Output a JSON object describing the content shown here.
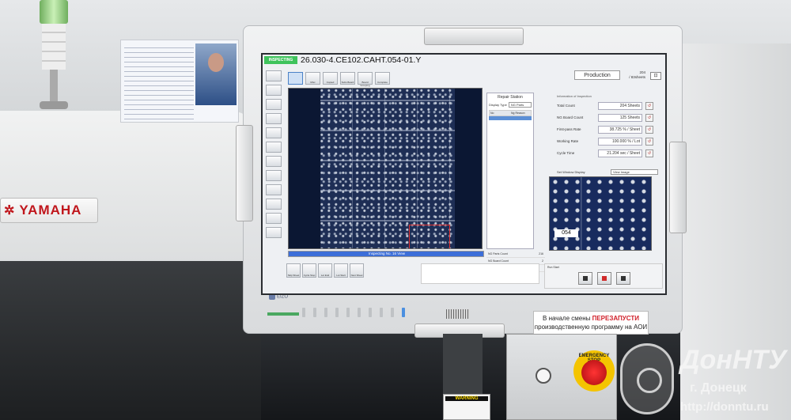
{
  "screen": {
    "status": "INSPECTING",
    "program_name": "26.030-4.CE102.CAHT.054-01.Y",
    "mode": "Production",
    "sheet_count": "204",
    "sheet_unit": "/ 83sheets",
    "fullscreen_icon": "fullscreen-icon",
    "left_tools": [
      "",
      "",
      "",
      "",
      "",
      "",
      "",
      "",
      "",
      "",
      "",
      ""
    ],
    "top_tools": [
      "",
      "Misc",
      "Copied",
      "Subs Board",
      "Board Grouping",
      "Complete"
    ],
    "repair_station": {
      "title": "Repair Station",
      "display_type_label": "Display Type",
      "display_type_value": "NG Parts",
      "col_no": "No",
      "col_name": "Ng Reason"
    },
    "inspect_info": [
      {
        "label": "NG Parts Count",
        "value": "216"
      },
      {
        "label": "NG Board Count",
        "value": "2"
      },
      {
        "label": "NG Sheet Count",
        "value": ""
      }
    ],
    "stats_title": "Information of Inspection",
    "stats": [
      {
        "label": "Total Count",
        "value": "204",
        "unit": "Sheets"
      },
      {
        "label": "NG Board Count",
        "value": "125",
        "unit": "Sheets"
      },
      {
        "label": "First-pass Rate",
        "value": "38.725",
        "unit": "% / Sheet"
      },
      {
        "label": "Working Rate",
        "value": "100.000",
        "unit": "% / Lot"
      },
      {
        "label": "Cycle Time",
        "value": "21.204",
        "unit": "sec / Sheet"
      }
    ],
    "view_label": "Set Window Display",
    "view_option": "View Image",
    "component_label": "054",
    "progress_text": "Inspecting No. 16 View",
    "progress_value": 1.0,
    "bottom_buttons": [
      "Skip Sheet",
      "Cycle Stop",
      "Lot End",
      "Lot Start",
      "Next Sheet"
    ],
    "run_area_label": "Run Start"
  },
  "environment": {
    "brand": "YAMAHA",
    "sticker_line1_prefix": "В начале смены ",
    "sticker_line1_emphasis": "ПЕРЕЗАПУСТИ",
    "sticker_line2": "производственную программу на АОИ",
    "monitor_brand": "EIZO",
    "estop_label": "EMERGENCY STOP",
    "warning": "WARNING",
    "watermark_title": "ДонНТУ",
    "watermark_city": "г. Донецк",
    "watermark_url": "http://donntu.ru"
  },
  "colors": {
    "status_green": "#3fc35c",
    "progress_blue": "#3c6ed8",
    "estop_red": "#d02020",
    "brand_red": "#c0161c"
  }
}
